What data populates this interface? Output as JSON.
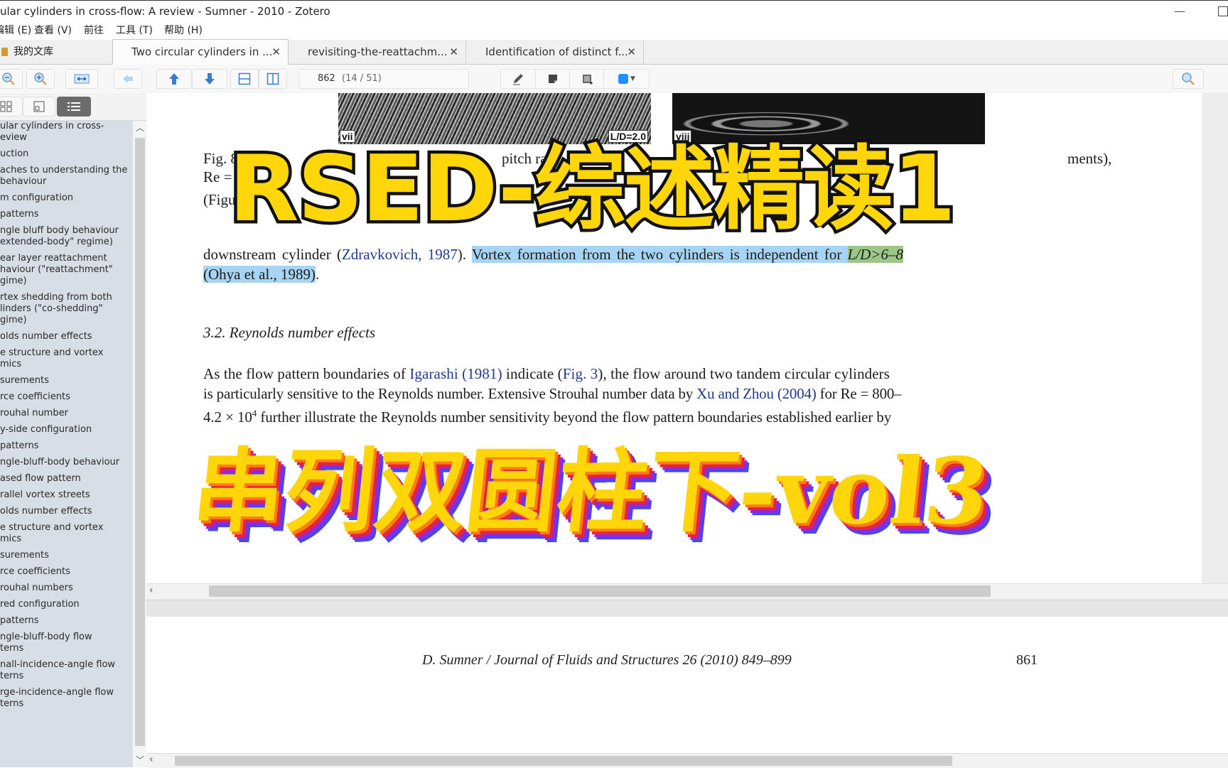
{
  "window": {
    "title": "ular cylinders in cross-flow: A review - Sumner - 2010 - Zotero",
    "minimize_glyph": "—"
  },
  "menu": {
    "items": [
      "编辑 (E)",
      "查看 (V)",
      "前往",
      "工具 (T)",
      "帮助 (H)"
    ]
  },
  "tabs": {
    "library_label": "我的文库",
    "documents": [
      {
        "label": "Two circular cylinders in ...",
        "active": true
      },
      {
        "label": "revisiting-the-reattachm...",
        "active": false
      },
      {
        "label": "Identification of distinct f...",
        "active": false
      }
    ],
    "close_glyph": "✕"
  },
  "toolbar": {
    "page_number": "862",
    "page_position": "(14 / 51)",
    "highlight_color": "#1e90ff"
  },
  "outline": {
    "items": [
      "ular cylinders in cross-\neview",
      "uction",
      "aches to understanding the\nbehaviour",
      "m configuration",
      " patterns",
      "ngle bluff body behaviour\nextended-body\" regime)",
      "ear layer reattachment\nhaviour (\"reattachment\"\ngime)",
      "rtex shedding from both\nlinders (\"co-shedding\"\ngime)",
      "olds number effects",
      "e structure and vortex\nmics",
      "surements",
      "rce coefficients",
      "rouhal number",
      "y-side configuration",
      " patterns",
      "ngle-bluff-body behaviour",
      "ased flow pattern",
      "rallel vortex streets",
      "olds number effects",
      "e structure and vortex\nmics",
      "surements",
      "rce coefficients",
      "rouhal numbers",
      "red configuration",
      " patterns",
      "ngle-bluff-body flow\nterns",
      "nall-incidence-angle flow\nterns",
      "rge-incidence-angle flow\nterns"
    ]
  },
  "document": {
    "figure_labels": {
      "left": "vii",
      "left_ratio": "L/D=2.0",
      "right": "viii"
    },
    "caption_line1_start": "Fig.  8",
    "caption_line1_mid": "pitch  rati",
    "caption_line1_end": "ments),",
    "caption_line2": "Re = 1",
    "caption_line3": "(Figur",
    "para1_pre": "downstream cylinder (",
    "para1_cite1": "Zdravkovich, 1987",
    "para1_mid": "). ",
    "para1_highlight": "Vortex formation from the two cylinders is independent for ",
    "para1_green": "L/D>6–8",
    "para1_line2_cite": "(Ohya et al., 1989)",
    "para1_line2_end": ".",
    "section_heading": "3.2.  Reynolds number effects",
    "para2_line1_pre": "   As the flow pattern boundaries of ",
    "para2_cite_igarashi": "Igarashi (1981)",
    "para2_line1_mid": " indicate (",
    "para2_fig_ref": "Fig. 3",
    "para2_line1_end": "), the flow around two tandem circular cylinders",
    "para2_line2_pre": "is particularly sensitive to the Reynolds number. Extensive Strouhal number data by ",
    "para2_cite_xu": "Xu and Zhou (2004)",
    "para2_line2_end": " for Re = 800–",
    "para2_line3_pre": "4.2 × 10",
    "para2_line3_sup": "4",
    "para2_line3_end": " further illustrate the Reynolds number sensitivity beyond the flow pattern boundaries established earlier by",
    "footer_journal": "D. Sumner / Journal of Fluids and Structures 26 (2010) 849–899",
    "footer_page": "861"
  },
  "overlay": {
    "top_title": "RSED-综述精读1",
    "bottom_title": "串列双圆柱下-vol3",
    "fill_color": "#ffd60a"
  }
}
